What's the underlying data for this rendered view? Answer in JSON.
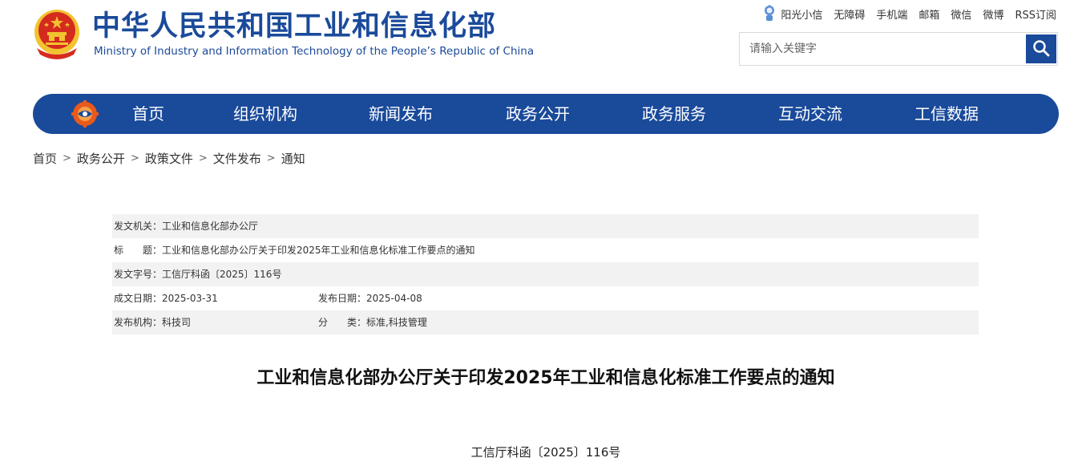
{
  "header": {
    "title": "中华人民共和国工业和信息化部",
    "subtitle": "Ministry of Industry and Information Technology of the People’s Republic of China"
  },
  "toplinks": [
    "阳光小信",
    "无障碍",
    "手机端",
    "邮箱",
    "微信",
    "微博",
    "RSS订阅"
  ],
  "search": {
    "placeholder": "请输入关键字"
  },
  "nav": {
    "items": [
      "首页",
      "组织机构",
      "新闻发布",
      "政务公开",
      "政务服务",
      "互动交流",
      "工信数据"
    ]
  },
  "breadcrumb": [
    "首页",
    "政务公开",
    "政策文件",
    "文件发布",
    "通知"
  ],
  "info": {
    "issuer": "发文机关：工业和信息化部办公厅",
    "title": "标　　题：工业和信息化部办公厅关于印发2025年工业和信息化标准工作要点的通知",
    "doc_no": "发文字号：工信厅科函〔2025〕116号",
    "created": "成文日期：2025-03-31",
    "published": "发布日期：2025-04-08",
    "org": "发布机构：科技司",
    "category": "分　　类：标准,科技管理"
  },
  "article": {
    "title": "工业和信息化部办公厅关于印发2025年工业和信息化标准工作要点的通知",
    "doc_number": "工信厅科函〔2025〕116号"
  },
  "colors": {
    "brand": "#1a4a9a",
    "shade": "#f2f2f2",
    "emblem_red": "#d52b1e",
    "emblem_gold": "#f2c230"
  }
}
